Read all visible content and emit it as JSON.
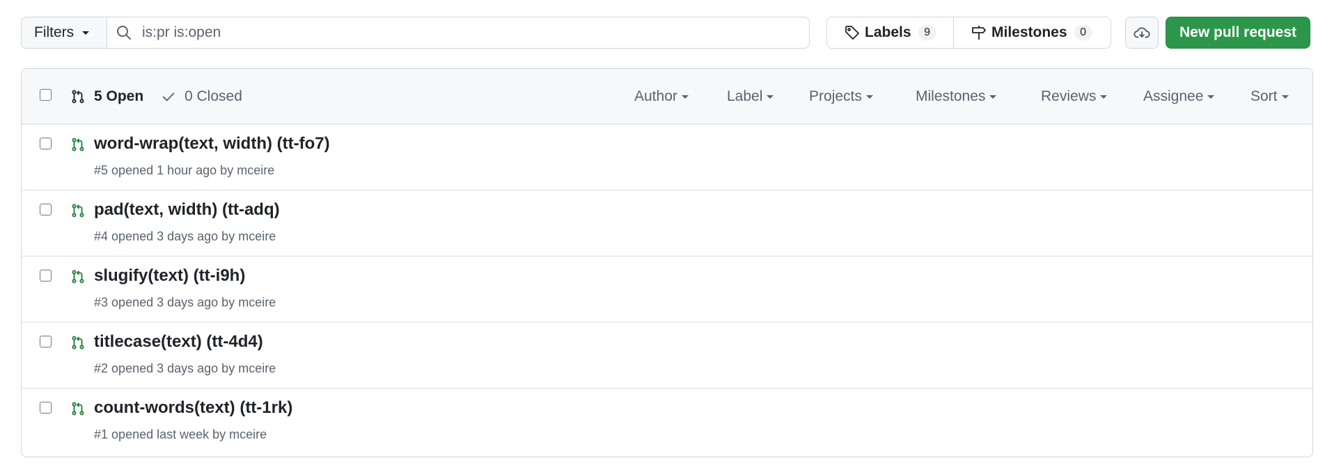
{
  "toolbar": {
    "filters_label": "Filters",
    "search_value": "is:pr is:open",
    "labels_label": "Labels",
    "labels_count": "9",
    "milestones_label": "Milestones",
    "milestones_count": "0",
    "new_pr_label": "New pull request"
  },
  "list_header": {
    "open_label": "5 Open",
    "closed_label": "0 Closed",
    "filters": [
      "Author",
      "Label",
      "Projects",
      "Milestones",
      "Reviews",
      "Assignee",
      "Sort"
    ]
  },
  "pull_requests": [
    {
      "title": "word-wrap(text, width) (tt-fo7)",
      "number": "#5",
      "opened_text": "opened 1 hour ago by",
      "author": "mceire"
    },
    {
      "title": "pad(text, width) (tt-adq)",
      "number": "#4",
      "opened_text": "opened 3 days ago by",
      "author": "mceire"
    },
    {
      "title": "slugify(text) (tt-i9h)",
      "number": "#3",
      "opened_text": "opened 3 days ago by",
      "author": "mceire"
    },
    {
      "title": "titlecase(text) (tt-4d4)",
      "number": "#2",
      "opened_text": "opened 3 days ago by",
      "author": "mceire"
    },
    {
      "title": "count-words(text) (tt-1rk)",
      "number": "#1",
      "opened_text": "opened last week by",
      "author": "mceire"
    }
  ],
  "colors": {
    "accent_green": "#2c974b",
    "open_icon_green": "#1a7f37",
    "muted_text": "#59636e",
    "border": "#d0d7de"
  },
  "icons": [
    "caret-down-icon",
    "search-icon",
    "tag-icon",
    "milestone-icon",
    "cloud-icon",
    "git-pull-request-icon",
    "check-icon"
  ]
}
